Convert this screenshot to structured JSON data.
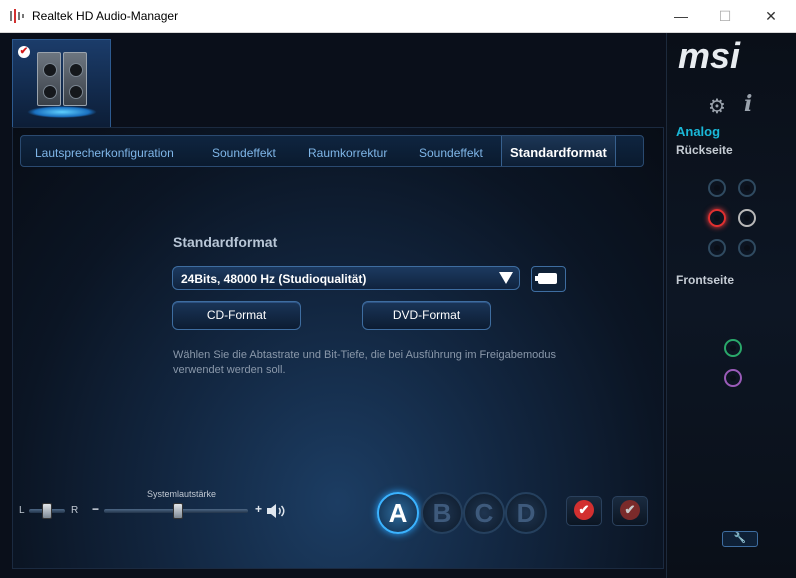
{
  "window": {
    "title": "Realtek HD Audio-Manager",
    "minimize": "—",
    "maximize": "☐",
    "close": "✕"
  },
  "tabs": [
    {
      "label": "Lautsprecherkonfiguration",
      "active": false
    },
    {
      "label": "Soundeffekt",
      "active": false
    },
    {
      "label": "Raumkorrektur",
      "active": false
    },
    {
      "label": "Soundeffekt",
      "active": false
    },
    {
      "label": "Standardformat",
      "active": true
    }
  ],
  "main": {
    "section_title": "Standardformat",
    "format_select_value": "24Bits, 48000 Hz (Studioqualität)",
    "cd_button": "CD-Format",
    "dvd_button": "DVD-Format",
    "description": "Wählen Sie die Abtastrate und Bit-Tiefe, die bei Ausführung im Freigabemodus verwendet werden soll."
  },
  "volume": {
    "label": "Systemlautstärke",
    "left": "L",
    "right": "R",
    "minus": "−",
    "plus": "+"
  },
  "profiles": [
    "A",
    "B",
    "C",
    "D"
  ],
  "sidebar": {
    "brand": "msi",
    "analog": "Analog",
    "rear": "Rückseite",
    "front": "Frontseite"
  },
  "colors": {
    "accent": "#1ab8d8",
    "jack_red": "#e23030",
    "jack_green": "#2aa86a",
    "jack_purple": "#9a5bb8",
    "jack_idle": "#2f4a60"
  }
}
